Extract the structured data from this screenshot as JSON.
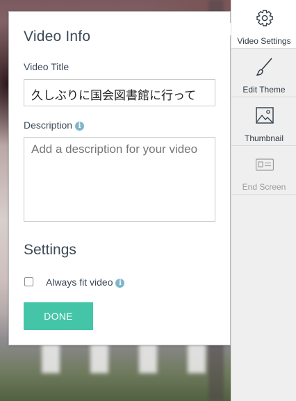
{
  "panel": {
    "heading": "Video Info",
    "title_label": "Video Title",
    "title_value": "久しぶりに国会図書館に行って",
    "description_label": "Description",
    "description_placeholder": "Add a description for your video",
    "settings_heading": "Settings",
    "always_fit_label": "Always fit video",
    "always_fit_checked": false,
    "done_label": "DONE"
  },
  "sidebar": {
    "items": [
      {
        "label": "Video Settings",
        "icon": "gear-icon",
        "active": true
      },
      {
        "label": "Edit Theme",
        "icon": "brush-icon",
        "active": false
      },
      {
        "label": "Thumbnail",
        "icon": "image-icon",
        "active": false
      },
      {
        "label": "End Screen",
        "icon": "end-screen-icon",
        "active": false,
        "disabled": true
      }
    ]
  },
  "colors": {
    "accent": "#44c5a8",
    "info_icon": "#7fb6c9",
    "heading_text": "#3d4a57"
  }
}
